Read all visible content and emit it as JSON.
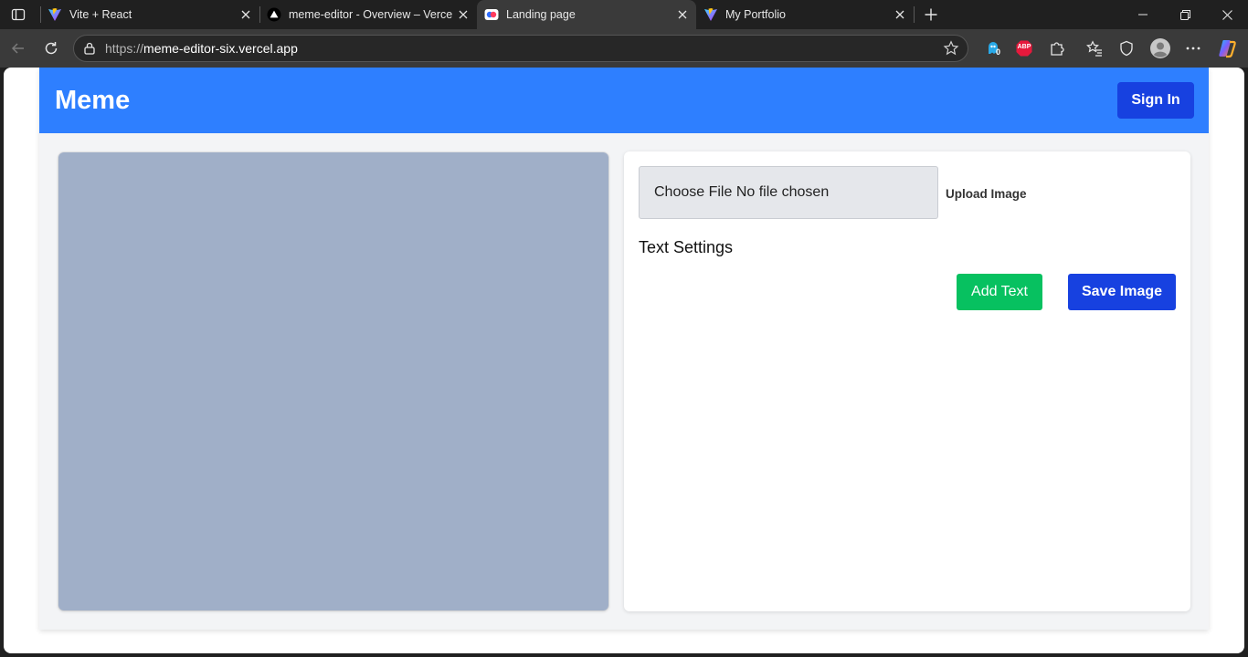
{
  "browser": {
    "tabs": [
      {
        "title": "Vite + React",
        "icon": "vite-icon"
      },
      {
        "title": "meme-editor - Overview – Vercel",
        "icon": "vercel-icon"
      },
      {
        "title": "Landing page",
        "icon": "landing-icon",
        "active": true
      },
      {
        "title": "My Portfolio",
        "icon": "vite-icon"
      }
    ],
    "url_scheme": "https://",
    "url_host": "meme-editor-six.vercel.app",
    "extension_badge": "0",
    "abp_label": "ABP"
  },
  "header": {
    "brand": "Meme",
    "signin_label": "Sign In",
    "color": "#2e7fff"
  },
  "editor": {
    "file_input_text": "Choose File No file chosen",
    "upload_label": "Upload Image",
    "settings_title": "Text Settings",
    "add_text_label": "Add Text",
    "save_image_label": "Save Image",
    "add_color": "#07c160",
    "save_color": "#1741e0",
    "canvas_color": "#a0afc8"
  }
}
